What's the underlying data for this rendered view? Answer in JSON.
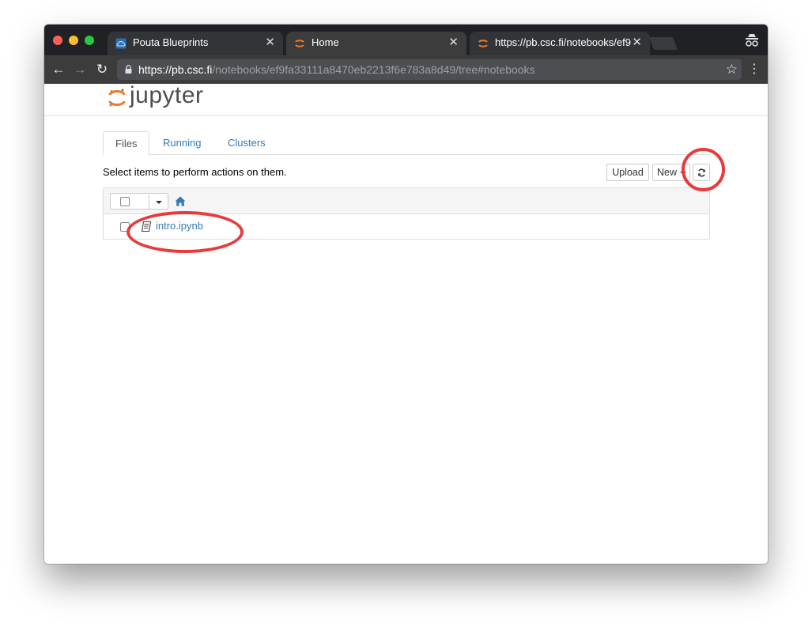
{
  "browser": {
    "tabs": [
      {
        "title": "Pouta Blueprints",
        "close": "✕"
      },
      {
        "title": "Home",
        "close": "✕"
      },
      {
        "title": "https://pb.csc.fi/notebooks/ef9",
        "close": "✕"
      }
    ],
    "url_host": "https://pb.csc.fi",
    "url_path": "/notebooks/ef9fa33111a8470eb2213f6e783a8d49/tree#notebooks"
  },
  "jupyter": {
    "logo_text": "jupyter",
    "tabs": [
      "Files",
      "Running",
      "Clusters"
    ],
    "instructions": "Select items to perform actions on them.",
    "buttons": {
      "upload": "Upload",
      "new": "New"
    },
    "files": [
      {
        "name": "intro.ipynb",
        "type": "notebook"
      }
    ]
  },
  "colors": {
    "accent": "#337ab7",
    "jupyter_orange": "#f37726",
    "annotation": "#e8393c"
  }
}
